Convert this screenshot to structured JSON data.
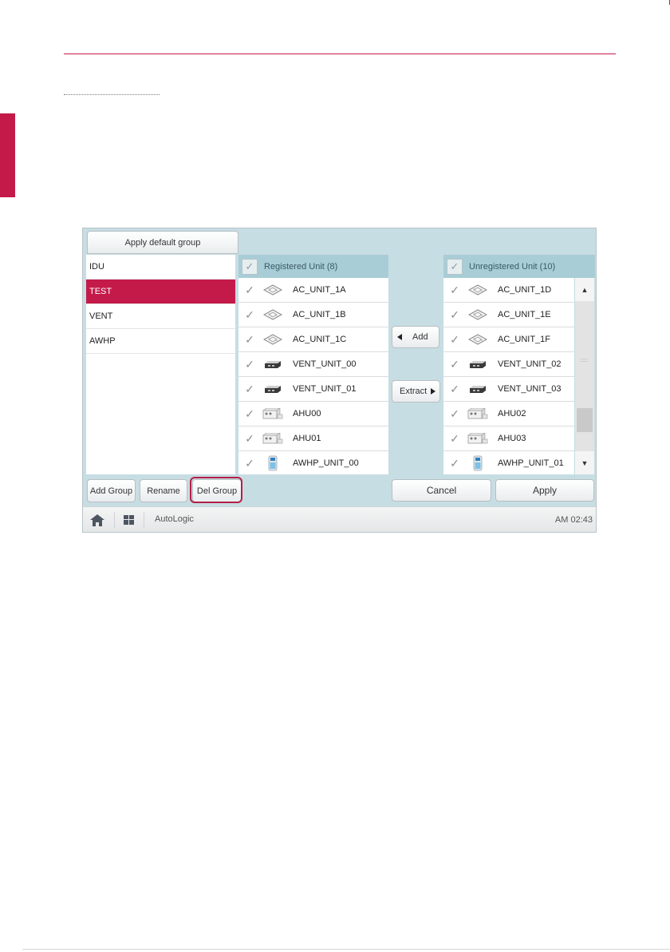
{
  "screen": {
    "apply_default_group_label": "Apply default group",
    "groups": [
      {
        "label": "IDU",
        "selected": false
      },
      {
        "label": "TEST",
        "selected": true
      },
      {
        "label": "VENT",
        "selected": false
      },
      {
        "label": "AWHP",
        "selected": false
      }
    ],
    "registered": {
      "header": "Registered Unit (8)",
      "units": [
        {
          "name": "AC_UNIT_1A",
          "icon": "cassette-icon"
        },
        {
          "name": "AC_UNIT_1B",
          "icon": "cassette-icon"
        },
        {
          "name": "AC_UNIT_1C",
          "icon": "cassette-icon"
        },
        {
          "name": "VENT_UNIT_00",
          "icon": "vent-unit-icon"
        },
        {
          "name": "VENT_UNIT_01",
          "icon": "vent-unit-icon"
        },
        {
          "name": "AHU00",
          "icon": "ahu-icon"
        },
        {
          "name": "AHU01",
          "icon": "ahu-icon"
        },
        {
          "name": "AWHP_UNIT_00",
          "icon": "awhp-icon"
        }
      ]
    },
    "unregistered": {
      "header": "Unregistered Unit (10)",
      "units": [
        {
          "name": "AC_UNIT_1D",
          "icon": "cassette-icon"
        },
        {
          "name": "AC_UNIT_1E",
          "icon": "cassette-icon"
        },
        {
          "name": "AC_UNIT_1F",
          "icon": "cassette-icon"
        },
        {
          "name": "VENT_UNIT_02",
          "icon": "vent-unit-icon"
        },
        {
          "name": "VENT_UNIT_03",
          "icon": "vent-unit-icon"
        },
        {
          "name": "AHU02",
          "icon": "ahu-icon"
        },
        {
          "name": "AHU03",
          "icon": "ahu-icon"
        },
        {
          "name": "AWHP_UNIT_01",
          "icon": "awhp-icon"
        }
      ],
      "scroll_position": 0.85
    },
    "add_label": "Add",
    "extract_label": "Extract",
    "add_group_label": "Add Group",
    "rename_label": "Rename",
    "del_group_label": "Del Group",
    "cancel_label": "Cancel",
    "apply_label": "Apply",
    "status_bar": {
      "app_name": "AutoLogic",
      "time": "AM 02:43"
    },
    "colors": {
      "accent": "#c41a4a",
      "highlight_outline": "#b51e48",
      "panel_header": "#a8cdd6",
      "screen_background": "#c6dde3"
    }
  }
}
